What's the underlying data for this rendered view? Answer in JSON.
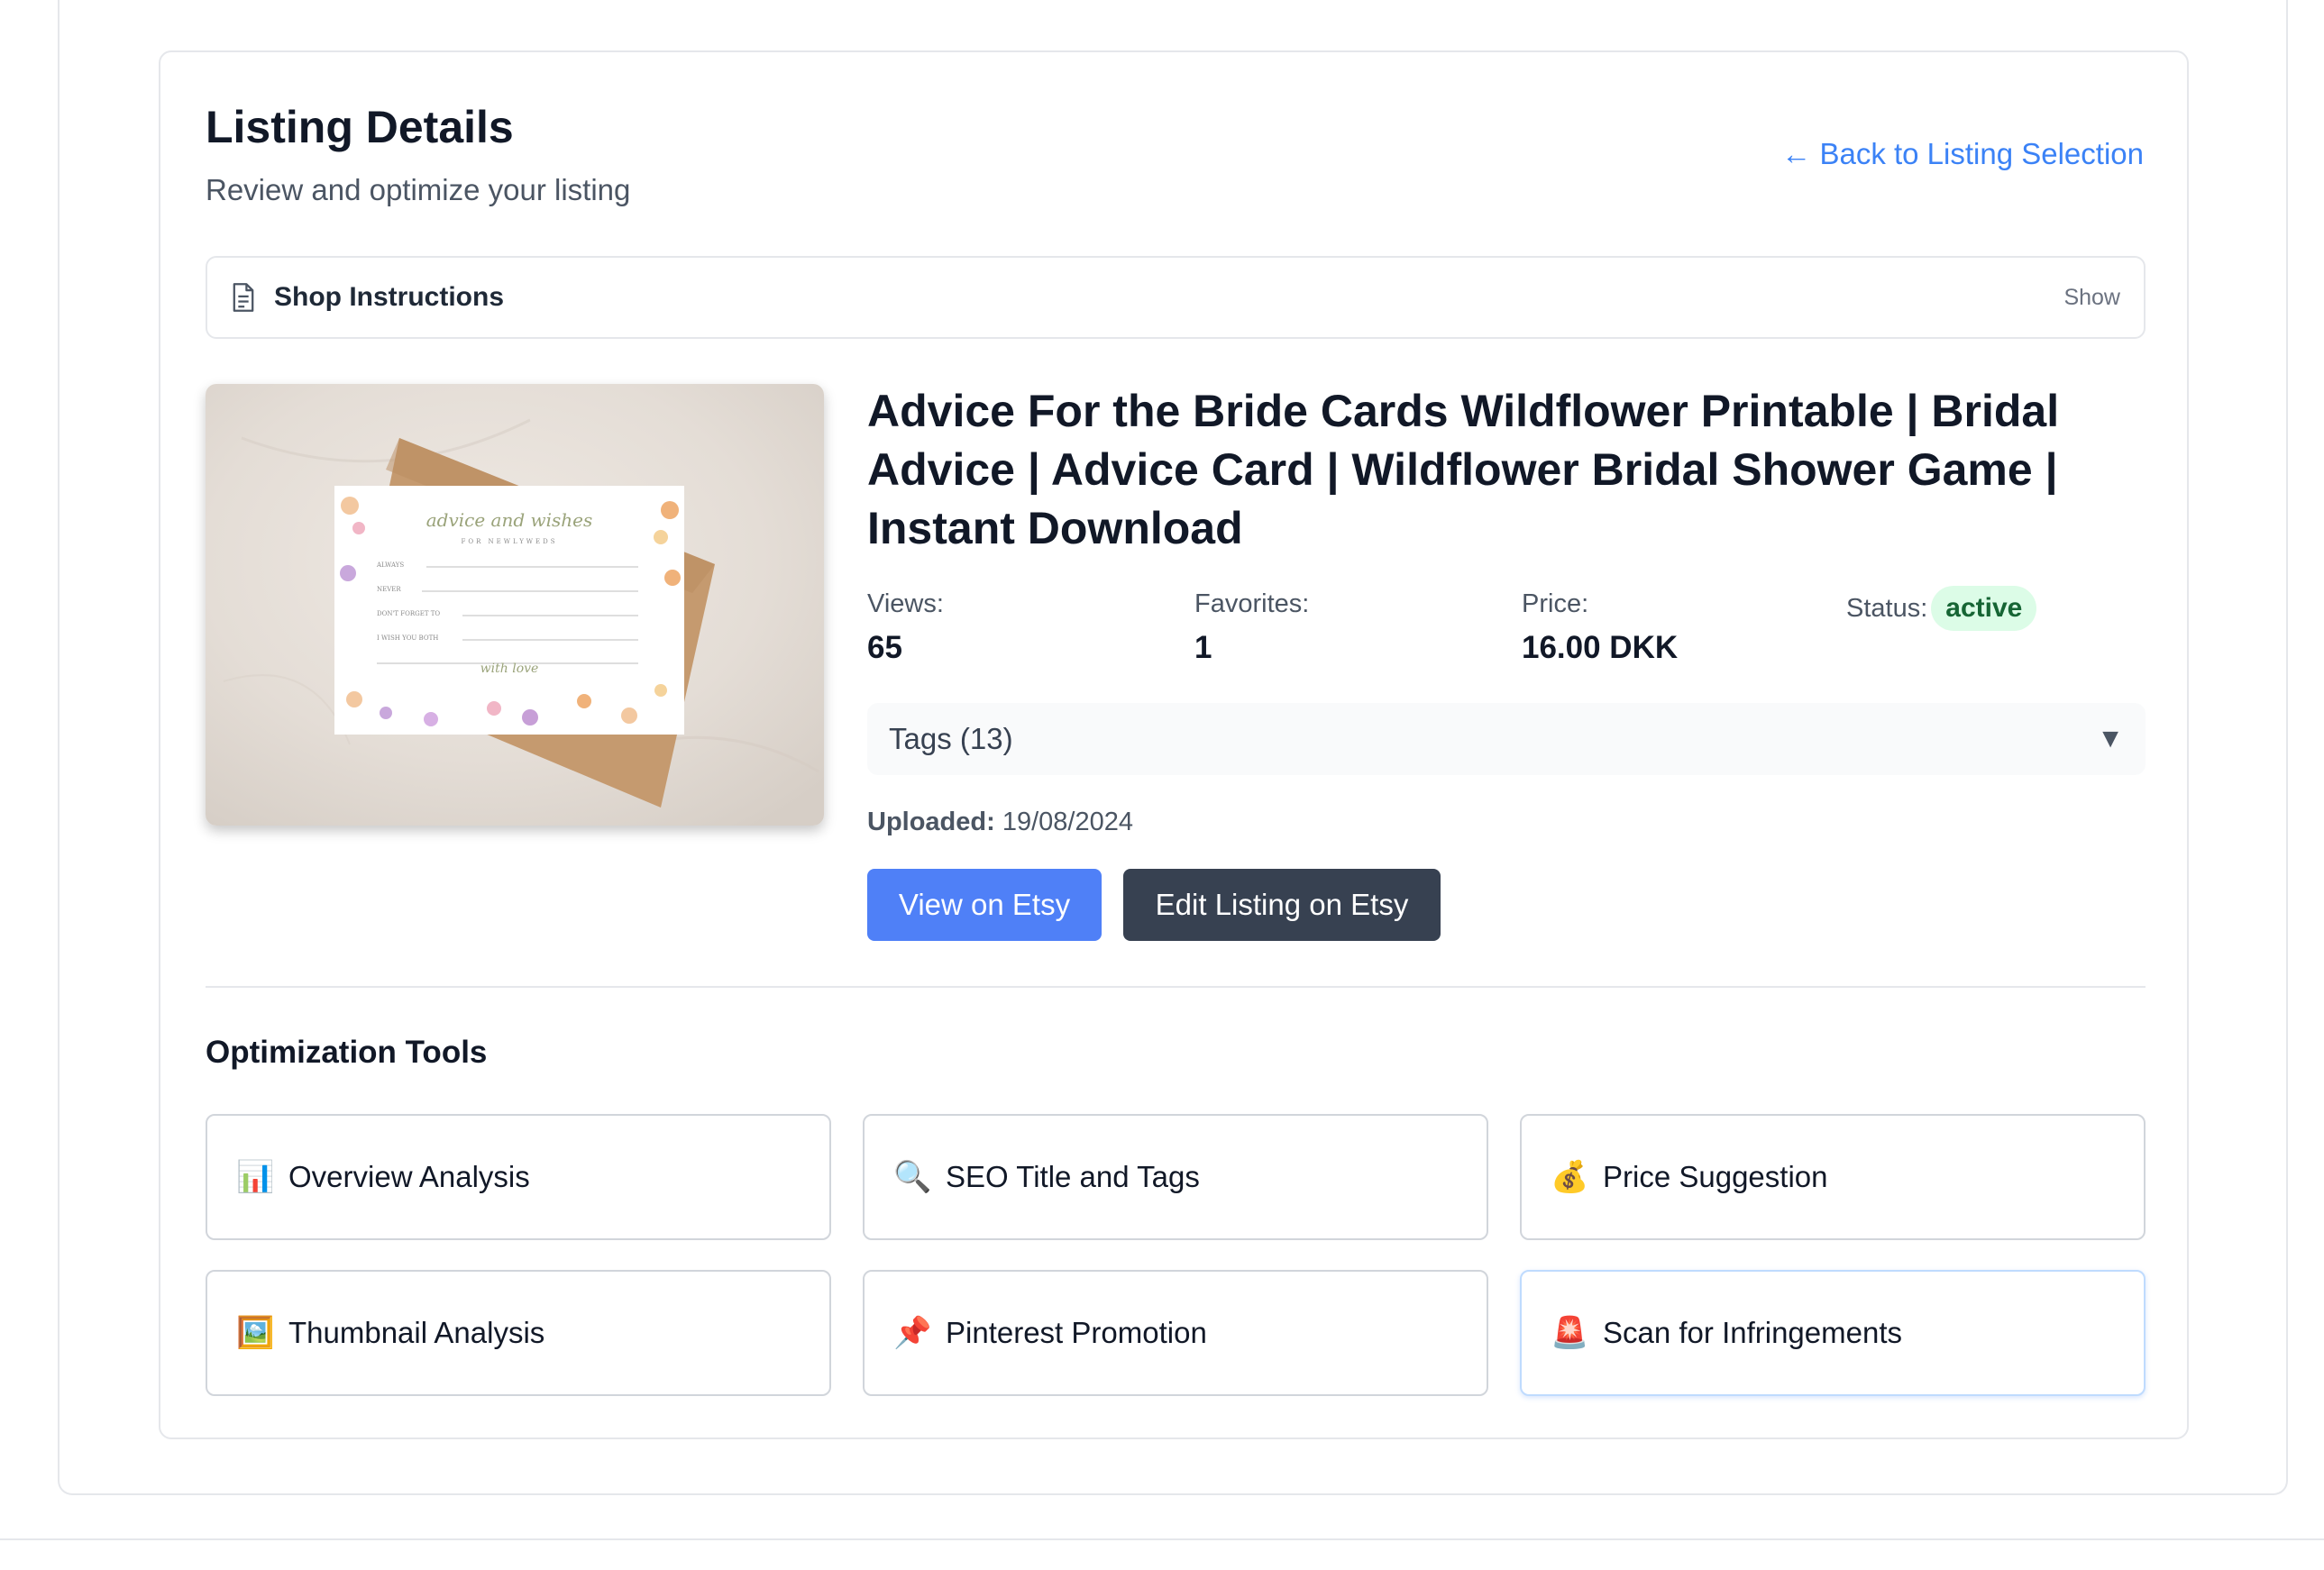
{
  "header": {
    "title": "Listing Details",
    "subtitle": "Review and optimize your listing",
    "back_link": "← Back to Listing Selection"
  },
  "instructions": {
    "icon": "document-icon",
    "label": "Shop Instructions",
    "toggle": "Show"
  },
  "listing": {
    "title": "Advice For the Bride Cards Wildflower Printable | Bridal Advice | Advice Card | Wildflower Bridal Shower Game | Instant Download",
    "thumbnail": {
      "heading": "advice and wishes",
      "subheading": "FOR NEWLYWEDS",
      "lines": [
        "ALWAYS",
        "NEVER",
        "DON'T FORGET TO",
        "I WISH YOU BOTH"
      ],
      "signoff": "with love"
    },
    "stats": {
      "views_label": "Views:",
      "views": "65",
      "favorites_label": "Favorites:",
      "favorites": "1",
      "price_label": "Price:",
      "price": "16.00 DKK",
      "status_label": "Status:",
      "status": "active"
    },
    "tags_label": "Tags (13)",
    "tags_caret": "▼",
    "uploaded_label": "Uploaded:",
    "uploaded": "19/08/2024",
    "view_button": "View on Etsy",
    "edit_button": "Edit Listing on Etsy"
  },
  "tools": {
    "title": "Optimization Tools",
    "items": [
      {
        "icon": "bar-chart-icon",
        "emoji": "📊",
        "label": "Overview Analysis"
      },
      {
        "icon": "magnifier-icon",
        "emoji": "🔍",
        "label": "SEO Title and Tags"
      },
      {
        "icon": "money-bag-icon",
        "emoji": "💰",
        "label": "Price Suggestion"
      },
      {
        "icon": "picture-icon",
        "emoji": "🖼️",
        "label": "Thumbnail Analysis"
      },
      {
        "icon": "pushpin-icon",
        "emoji": "📌",
        "label": "Pinterest Promotion"
      },
      {
        "icon": "siren-icon",
        "emoji": "🚨",
        "label": "Scan for Infringements"
      }
    ]
  },
  "colors": {
    "accent": "#3b82f6",
    "view_button": "#4f80f7",
    "edit_button": "#374151",
    "status_bg": "#dcfce7",
    "status_text": "#166534"
  }
}
